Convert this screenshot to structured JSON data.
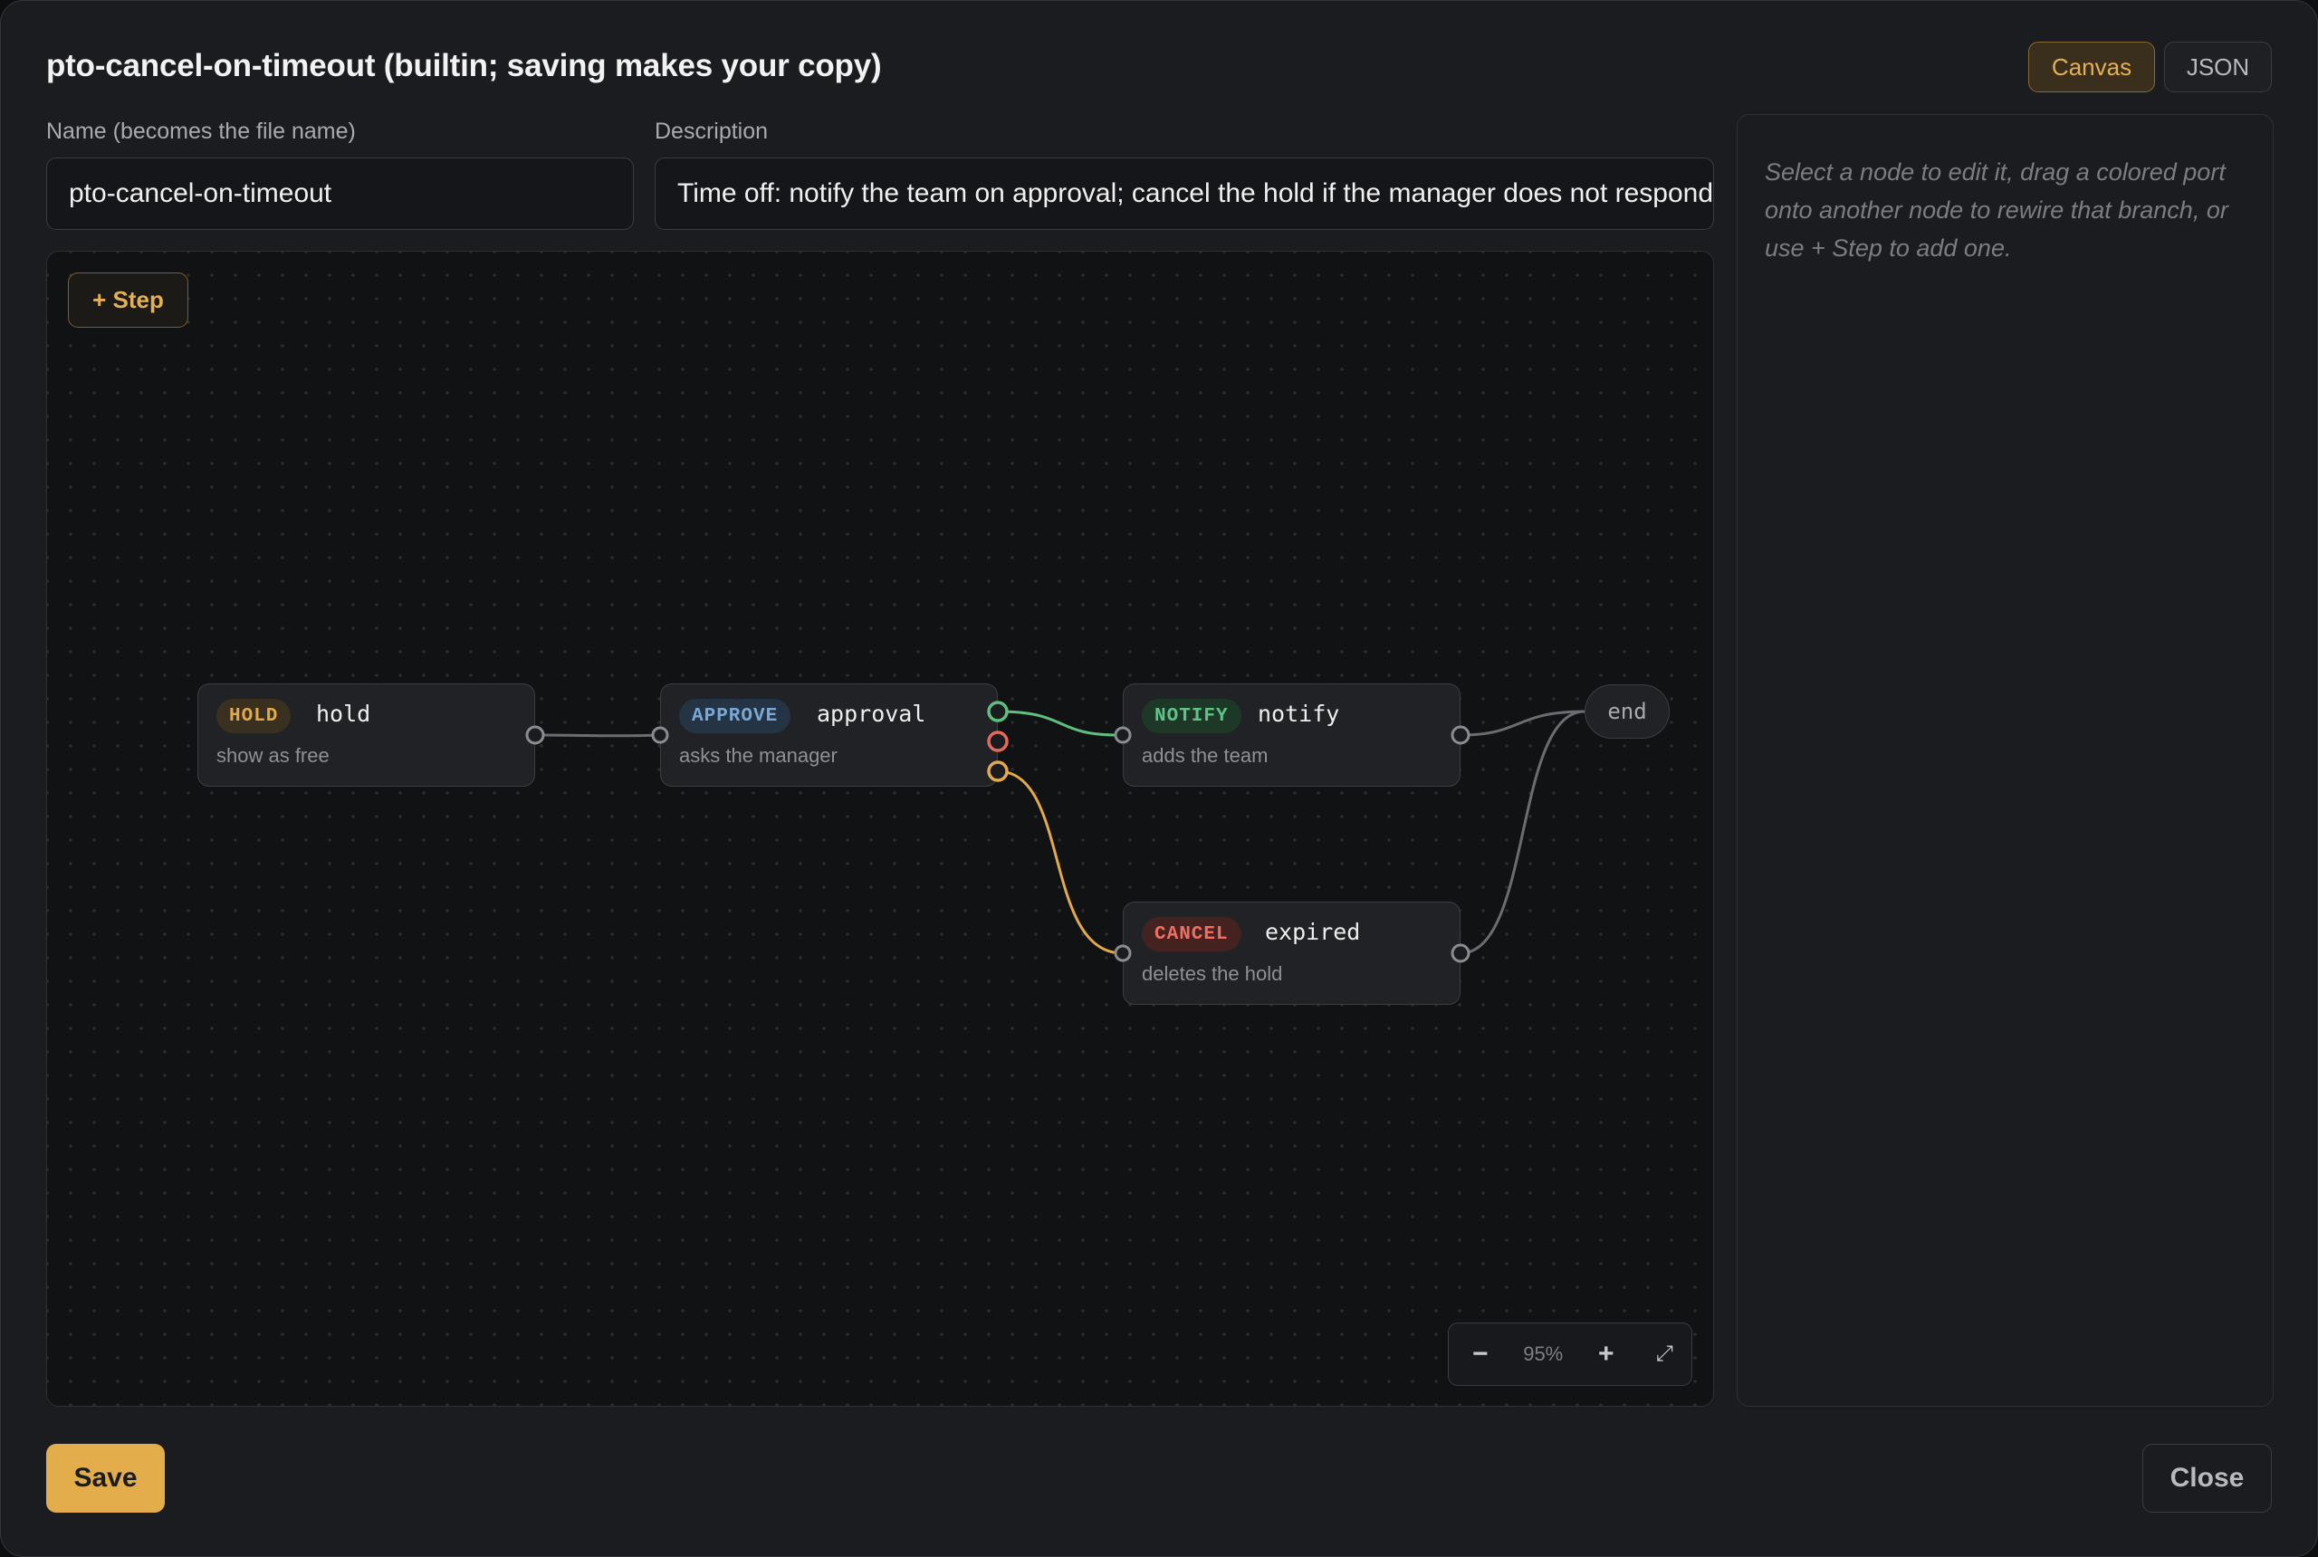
{
  "dialog": {
    "title": "pto-cancel-on-timeout (builtin; saving makes your copy)",
    "view_tabs": {
      "canvas": "Canvas",
      "json": "JSON",
      "active": "Canvas"
    }
  },
  "form": {
    "name_label": "Name (becomes the file name)",
    "name_value": "pto-cancel-on-timeout",
    "description_label": "Description",
    "description_value": "Time off: notify the team on approval; cancel the hold if the manager does not respond"
  },
  "canvas": {
    "add_step_label": "+ Step",
    "nodes": {
      "hold": {
        "badge": "HOLD",
        "name": "hold",
        "desc": "show as free"
      },
      "approval": {
        "badge": "APPROVE",
        "name": "approval",
        "desc": "asks the manager"
      },
      "notify": {
        "badge": "NOTIFY",
        "name": "notify",
        "desc": "adds the team"
      },
      "expired": {
        "badge": "CANCEL",
        "name": "expired",
        "desc": "deletes the hold"
      },
      "end": {
        "name": "end"
      }
    },
    "zoom": {
      "out_icon": "−",
      "level": "95%",
      "in_icon": "+",
      "fit_icon": "⤢"
    },
    "colors": {
      "approved_branch": "#5fbf7f",
      "rejected_branch": "#e46a5a",
      "timeout_branch": "#e3a94a",
      "default_wire": "#6b6d72"
    }
  },
  "inspector": {
    "hint": "Select a node to edit it, drag a colored port onto another node to rewire that branch, or use + Step to add one."
  },
  "footer": {
    "save_label": "Save",
    "close_label": "Close"
  },
  "colors": {
    "accent": "#e3ad4c"
  }
}
